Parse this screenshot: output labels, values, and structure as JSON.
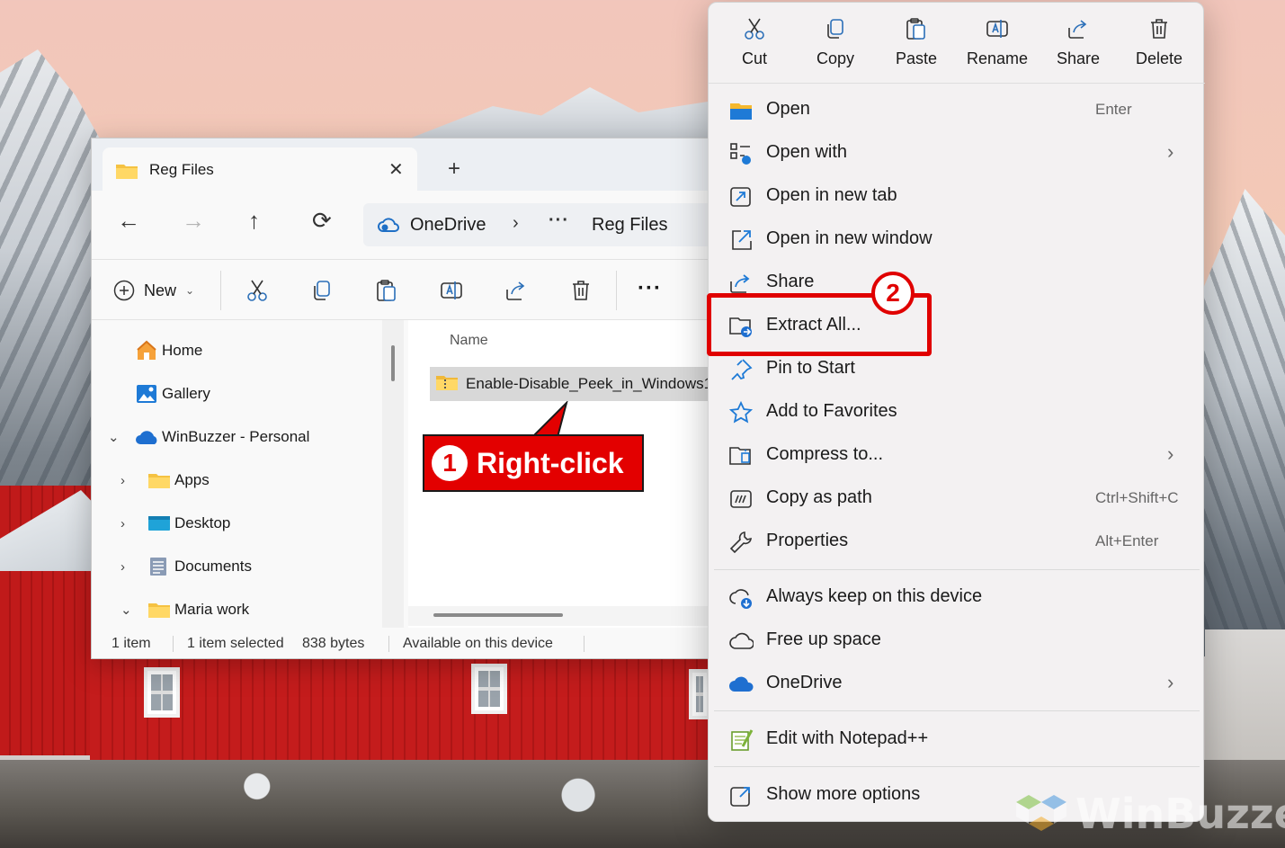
{
  "explorer": {
    "tab_title": "Reg Files",
    "address": {
      "root": "OneDrive",
      "current": "Reg Files"
    },
    "toolbar": {
      "new_label": "New"
    },
    "sidebar": [
      {
        "label": "Home",
        "icon": "home-icon"
      },
      {
        "label": "Gallery",
        "icon": "gallery-icon"
      },
      {
        "label": "WinBuzzer - Personal",
        "icon": "onedrive-icon",
        "expanded": true
      },
      {
        "label": "Apps",
        "icon": "folder-icon"
      },
      {
        "label": "Desktop",
        "icon": "desktop-folder-icon"
      },
      {
        "label": "Documents",
        "icon": "documents-folder-icon"
      },
      {
        "label": "Maria work",
        "icon": "folder-icon",
        "expanded": true
      }
    ],
    "column_header": "Name",
    "file_name": "Enable-Disable_Peek_in_Windows1",
    "status": {
      "count": "1 item",
      "selected": "1 item selected",
      "size": "838 bytes",
      "availability": "Available on this device"
    }
  },
  "annotations": {
    "step1_number": "1",
    "step1_label": "Right-click",
    "step2_number": "2",
    "highlight_color": "#e00000"
  },
  "context_menu": {
    "quick_actions": [
      {
        "label": "Cut",
        "icon": "scissors-icon"
      },
      {
        "label": "Copy",
        "icon": "copy-icon"
      },
      {
        "label": "Paste",
        "icon": "paste-icon"
      },
      {
        "label": "Rename",
        "icon": "rename-icon"
      },
      {
        "label": "Share",
        "icon": "share-icon"
      },
      {
        "label": "Delete",
        "icon": "trash-icon"
      }
    ],
    "items": [
      {
        "label": "Open",
        "shortcut": "Enter"
      },
      {
        "label": "Open with",
        "submenu": true
      },
      {
        "label": "Open in new tab"
      },
      {
        "label": "Open in new window"
      },
      {
        "label": "Share"
      },
      {
        "label": "Extract All..."
      },
      {
        "label": "Pin to Start"
      },
      {
        "label": "Add to Favorites"
      },
      {
        "label": "Compress to...",
        "submenu": true
      },
      {
        "label": "Copy as path",
        "shortcut": "Ctrl+Shift+C"
      },
      {
        "label": "Properties",
        "shortcut": "Alt+Enter"
      },
      {
        "label": "Always keep on this device"
      },
      {
        "label": "Free up space"
      },
      {
        "label": "OneDrive",
        "submenu": true
      },
      {
        "label": "Edit with Notepad++"
      },
      {
        "label": "Show more options"
      }
    ],
    "submenu_arrow": "›"
  },
  "watermark": "WinBuzzer"
}
